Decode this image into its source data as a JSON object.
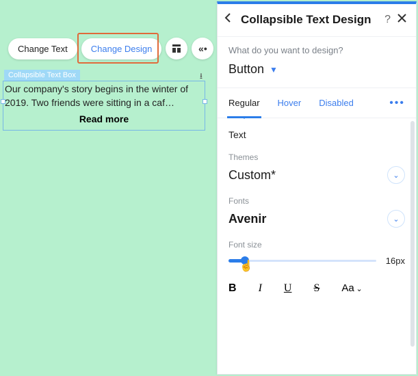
{
  "toolbar": {
    "change_text": "Change Text",
    "change_design": "Change Design"
  },
  "box": {
    "label": "Collapsible Text Box",
    "body": "Our company's story begins in the winter of 2019. Two friends were sitting in a caf…",
    "read_more": "Read more"
  },
  "panel": {
    "title": "Collapsible Text Design",
    "question": "What do you want to design?",
    "selector": "Button",
    "tabs": {
      "regular": "Regular",
      "hover": "Hover",
      "disabled": "Disabled"
    },
    "group": "Text",
    "themes_label": "Themes",
    "themes_value": "Custom*",
    "fonts_label": "Fonts",
    "fonts_value": "Avenir",
    "size_label": "Font size",
    "size_value": "16px",
    "fmt": {
      "b": "B",
      "i": "I",
      "u": "U",
      "s": "S",
      "aa": "Aa"
    }
  }
}
